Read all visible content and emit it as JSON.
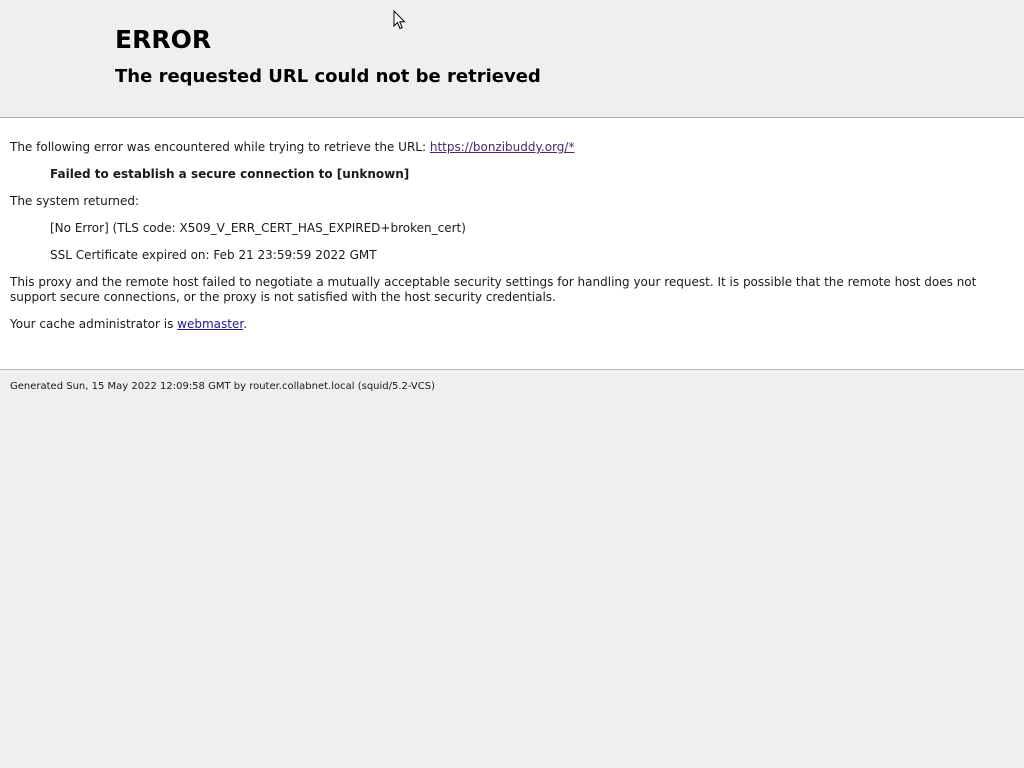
{
  "header": {
    "title": "ERROR",
    "subtitle": "The requested URL could not be retrieved"
  },
  "content": {
    "intro_text": "The following error was encountered while trying to retrieve the URL: ",
    "url_link": "https://bonzibuddy.org/*",
    "error_message": "Failed to establish a secure connection to [unknown]",
    "system_returned_label": "The system returned:",
    "tls_error": "[No Error] (TLS code: X509_V_ERR_CERT_HAS_EXPIRED+broken_cert)",
    "cert_expiry": "SSL Certificate expired on: Feb 21 23:59:59 2022 GMT",
    "explanation": "This proxy and the remote host failed to negotiate a mutually acceptable security settings for handling your request. It is possible that the remote host does not support secure connections, or the proxy is not satisfied with the host security credentials.",
    "admin_prefix": "Your cache administrator is ",
    "admin_link": "webmaster",
    "admin_suffix": "."
  },
  "footer": {
    "generated_text": "Generated Sun, 15 May 2022 12:09:58 GMT by router.collabnet.local (squid/5.2-VCS)"
  },
  "cursor": {
    "icon": "mouse-pointer-icon"
  }
}
